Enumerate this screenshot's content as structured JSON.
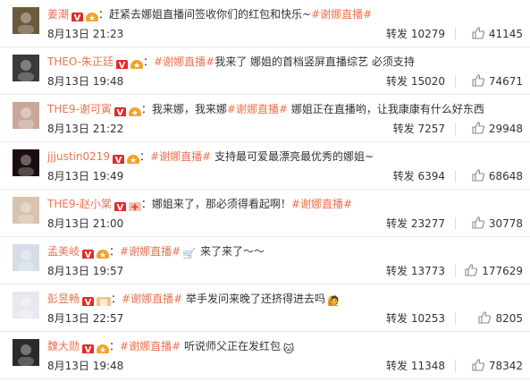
{
  "comments": [
    {
      "username": "姜潮",
      "badges": [
        "v",
        "star"
      ],
      "pre_text": "：赶紧去娜姐直播间签收你们的红包和快乐~",
      "topic": "#谢娜直播#",
      "post_text": "",
      "emoji": "",
      "time": "8月13日 21:23",
      "repost_label": "转发",
      "repost_count": "10279",
      "like_count": "41145",
      "avatar_color": "#6b5a3e",
      "avatar_icon": "avatar-photo"
    },
    {
      "username": "THEO-朱正廷",
      "badges": [
        "v",
        "star"
      ],
      "pre_text": "：",
      "topic": "#谢娜直播#",
      "post_text": "我来了 娜姐的首档竖屏直播综艺 必须支持",
      "emoji": "",
      "time": "8月13日 19:48",
      "repost_label": "转发",
      "repost_count": "15020",
      "like_count": "74671",
      "avatar_color": "#3a3a3a",
      "avatar_icon": "avatar-photo"
    },
    {
      "username": "THE9-谢可寅",
      "badges": [
        "v",
        "star"
      ],
      "pre_text": "：我来娜，我来娜",
      "topic": "#谢娜直播#",
      "post_text": " 娜姐正在直播哟，让我康康有什么好东西",
      "emoji": "",
      "time": "8月13日 21:22",
      "repost_label": "转发",
      "repost_count": "7257",
      "like_count": "29948",
      "avatar_color": "#c9a89a",
      "avatar_icon": "avatar-photo"
    },
    {
      "username": "jjjustin0219",
      "badges": [
        "v",
        "star"
      ],
      "pre_text": "：",
      "topic": "#谢娜直播#",
      "post_text": " 支持最可爱最漂亮最优秀的娜姐~",
      "emoji": "",
      "time": "8月13日 19:49",
      "repost_label": "转发",
      "repost_count": "6394",
      "like_count": "68648",
      "avatar_color": "#1a0e0e",
      "avatar_icon": "avatar-photo"
    },
    {
      "username": "THE9-赵小棠",
      "badges": [
        "v",
        "red"
      ],
      "pre_text": "：娜姐来了，那必须得看起啊！",
      "topic": "#谢娜直播#",
      "post_text": "",
      "emoji": "",
      "time": "8月13日 21:00",
      "repost_label": "转发",
      "repost_count": "23277",
      "like_count": "30778",
      "avatar_color": "#d8c3b0",
      "avatar_icon": "avatar-photo"
    },
    {
      "username": "孟美岐",
      "badges": [
        "v",
        "star"
      ],
      "pre_text": "：",
      "topic": "#谢娜直播#",
      "post_text": " 来了来了～～",
      "emoji": "🛒",
      "time": "8月13日 19:57",
      "repost_label": "转发",
      "repost_count": "13773",
      "like_count": "177629",
      "avatar_color": "#d6dde6",
      "avatar_icon": "avatar-photo"
    },
    {
      "username": "彭昱畅",
      "badges": [
        "v",
        "vip"
      ],
      "pre_text": "：",
      "topic": "#谢娜直播#",
      "post_text": " 举手发问来晚了还挤得进去吗",
      "emoji": "🙋",
      "time": "8月13日 22:57",
      "repost_label": "转发",
      "repost_count": "10253",
      "like_count": "8205",
      "avatar_color": "#e8e8ef",
      "avatar_icon": "avatar-photo"
    },
    {
      "username": "魏大勋",
      "badges": [
        "v",
        "star"
      ],
      "pre_text": "：",
      "topic": "#谢娜直播#",
      "post_text": " 听说师父正在发红包",
      "emoji": "🐱",
      "time": "8月13日 19:48",
      "repost_label": "转发",
      "repost_count": "11348",
      "like_count": "78342",
      "avatar_color": "#2a2a2a",
      "avatar_icon": "avatar-photo"
    }
  ],
  "colors": {
    "username": "#eb7350",
    "topic": "#eb7350",
    "verified_badge": "#e02b2b",
    "divider": "#eaeaea"
  },
  "icons": {
    "verified": "verified-v-icon",
    "like": "thumbs-up-icon"
  }
}
